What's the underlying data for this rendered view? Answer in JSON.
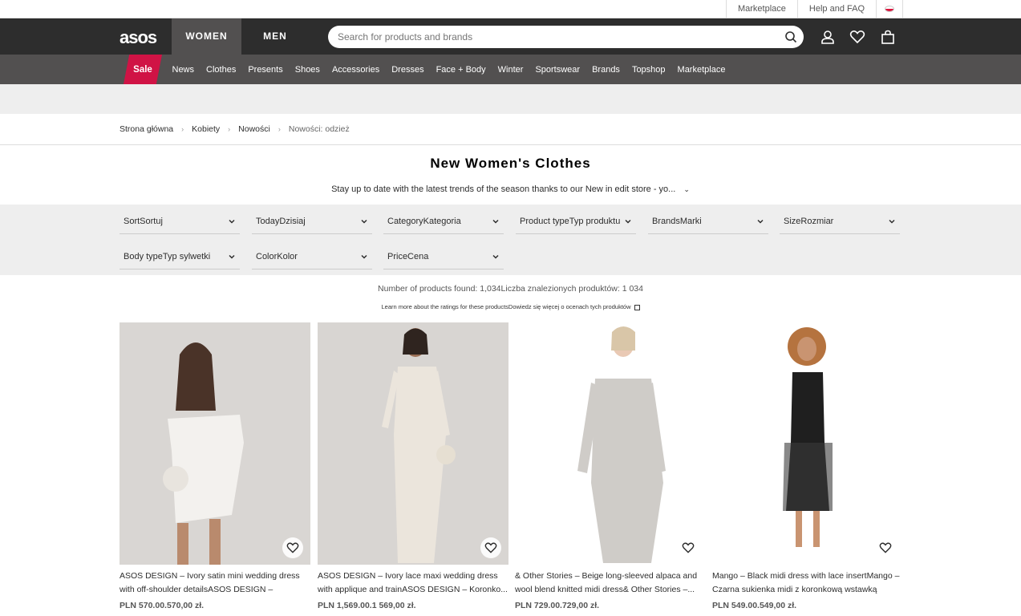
{
  "topbar": {
    "marketplace": "Marketplace",
    "help": "Help and FAQ",
    "flag_icon": "poland-flag-icon"
  },
  "header": {
    "logo": "asos",
    "women": "WOMEN",
    "men": "MEN",
    "search_placeholder": "Search for products and brands",
    "icons": [
      "search-icon",
      "account-icon",
      "heart-icon",
      "bag-icon"
    ]
  },
  "nav": {
    "sale": "Sale",
    "items": [
      "News",
      "Clothes",
      "Presents",
      "Shoes",
      "Accessories",
      "Dresses",
      "Face + Body",
      "Winter",
      "Sportswear",
      "Brands",
      "Topshop",
      "Marketplace"
    ]
  },
  "breadcrumbs": [
    "Strona główna",
    "Kobiety",
    "Nowości",
    "Nowości: odzież"
  ],
  "page": {
    "title": "New Women's Clothes",
    "subtitle": "Stay up to date with the latest trends of the season thanks to our New in edit store - yo..."
  },
  "filters": [
    "SortSortuj",
    "TodayDzisiaj",
    "CategoryKategoria",
    "Product typeTyp produktu",
    "BrandsMarki",
    "SizeRozmiar",
    "Body typeTyp sylwetki",
    "ColorKolor",
    "PriceCena"
  ],
  "results": {
    "count_text": "Number of products found: 1,034Liczba znalezionych produktów: 1 034",
    "ratings_link": "Learn more about the ratings for these productsDowiedz się więcej o ocenach tych produktów"
  },
  "products": [
    {
      "name": "ASOS DESIGN – Ivory satin mini wedding dress with off-shoulder detailsASOS DESIGN – Satynow...",
      "price": "PLN 570.00.570,00 zł."
    },
    {
      "name": "ASOS DESIGN – Ivory lace maxi wedding dress with applique and trainASOS DESIGN – Koronko...",
      "price": "PLN 1,569.00.1 569,00 zł."
    },
    {
      "name": "& Other Stories – Beige long-sleeved alpaca and wool blend knitted midi dress& Other Stories –...",
      "price": "PLN 729.00.729,00 zł."
    },
    {
      "name": "Mango – Black midi dress with lace insertMango – Czarna sukienka midi z koronkową wstawką",
      "price": "PLN 549.00.549,00 zł."
    }
  ],
  "colors": {
    "header": "#2d2d2d",
    "nav": "#525050",
    "sale": "#d01345",
    "filters_bg": "#eeeeee"
  }
}
